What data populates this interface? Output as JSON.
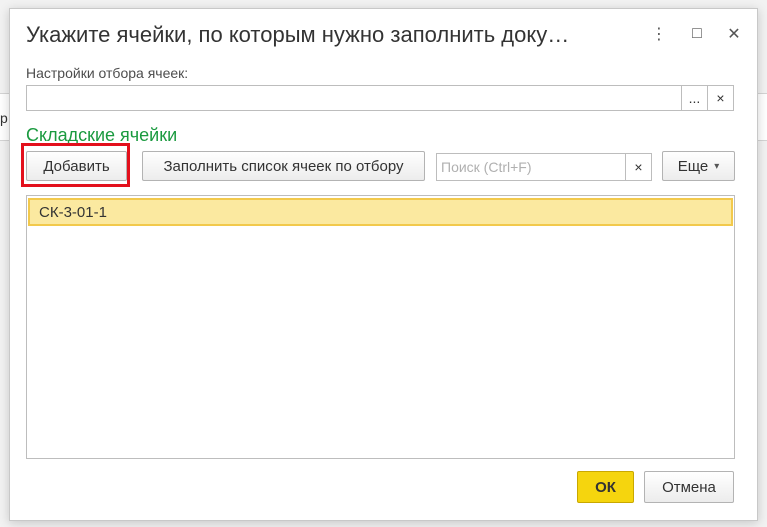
{
  "background": {
    "left_hint": "р"
  },
  "dialog": {
    "title": "Укажите ячейки, по которым нужно заполнить доку…",
    "window_controls": {
      "more": "⋮",
      "maximize": "□",
      "close": "✕"
    },
    "settings_label": "Настройки отбора ячеек:",
    "settings_value": "",
    "settings_select_btn": "...",
    "settings_clear_btn": "×",
    "section_title": "Складские ячейки",
    "toolbar": {
      "add_label": "Добавить",
      "fill_label": "Заполнить список ячеек по отбору",
      "search_placeholder": "Поиск (Ctrl+F)",
      "search_clear": "×",
      "more_label": "Еще",
      "more_arrow": "▾"
    },
    "list": {
      "rows": [
        "СК-3-01-1"
      ]
    },
    "footer": {
      "ok_label": "ОК",
      "cancel_label": "Отмена"
    }
  },
  "colors": {
    "section_title": "#1a9a3f",
    "ok_button": "#f5d50e",
    "selected_row": "#fbe9a0",
    "highlight_box": "#e3101c"
  }
}
